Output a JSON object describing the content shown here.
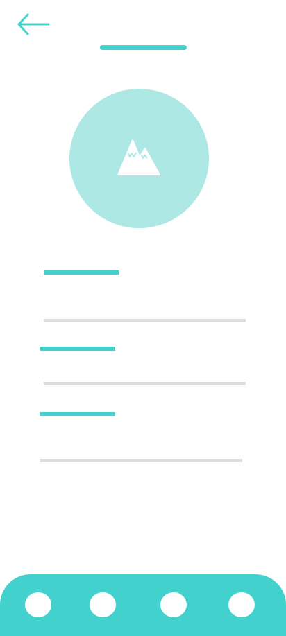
{
  "colors": {
    "accent": "#43d1cd",
    "avatar_bg": "#ade8e5",
    "divider": "#dcdcdc",
    "nav_bg": "#43d1cd",
    "icon_fill": "#ffffff"
  },
  "header": {
    "back_icon": "arrow-left-icon",
    "title": ""
  },
  "avatar": {
    "icon": "mountain-image-icon"
  },
  "form": {
    "fields": [
      {
        "label": "",
        "value": "",
        "placeholder": ""
      },
      {
        "label": "",
        "value": "",
        "placeholder": ""
      },
      {
        "label": "",
        "value": "",
        "placeholder": ""
      }
    ]
  },
  "bottom_nav": {
    "items": [
      {
        "icon": "nav-dot-icon"
      },
      {
        "icon": "nav-dot-icon"
      },
      {
        "icon": "nav-dot-icon"
      },
      {
        "icon": "nav-dot-icon"
      }
    ]
  }
}
